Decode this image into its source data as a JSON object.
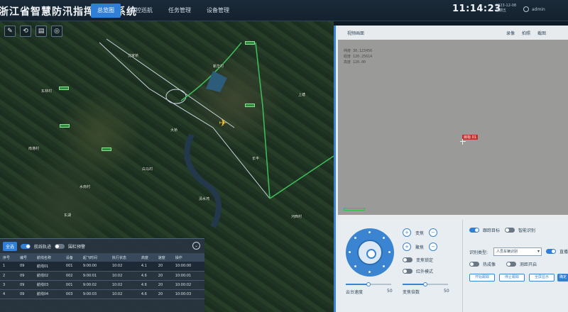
{
  "header": {
    "title": "浙江省智慧防汛指挥调度系统",
    "nav": [
      "总览图",
      "监控巡航",
      "任务管理",
      "设备管理"
    ],
    "active_nav": 0,
    "clock": "11:14:23",
    "date_line1": "2023-12-08",
    "date_line2": "星期五",
    "user": "admin"
  },
  "map": {
    "tools": [
      "edit-icon",
      "measure-icon",
      "layer-icon",
      "location-icon"
    ],
    "labels": [
      "东林村",
      "南港村",
      "沈家桥",
      "水南村",
      "新华村",
      "大桥",
      "上塘",
      "长丰",
      "东湖",
      "白马村",
      "清水湾",
      "河西村"
    ]
  },
  "list_panel": {
    "chip": "全选",
    "toggle1_label": "航线轨迹",
    "toggle2_label": "围栏预警",
    "columns": [
      "序号",
      "编号",
      "航线名称",
      "设备",
      "起飞时间",
      "执行状态",
      "高度",
      "速度",
      "操作"
    ],
    "rows": [
      [
        "1",
        "09",
        "航线01",
        "001",
        "9:00:00",
        "10:02",
        "4.1",
        "20",
        "10:00:00"
      ],
      [
        "2",
        "09",
        "航线02",
        "002",
        "9:00:01",
        "10:02",
        "4.6",
        "20",
        "10:00:01"
      ],
      [
        "3",
        "09",
        "航线03",
        "001",
        "9:00:02",
        "10:02",
        "4.6",
        "20",
        "10:00:02"
      ],
      [
        "4",
        "09",
        "航线04",
        "003",
        "9:00:03",
        "10:02",
        "4.6",
        "20",
        "10:00:03"
      ]
    ]
  },
  "video": {
    "title": "视频画面",
    "actions": [
      "录像",
      "拍照",
      "截图"
    ],
    "osd": "纬度 30.123456\n经度 120.25614\n高度 120.00",
    "target_label": "目标 01"
  },
  "controls": {
    "zoom_in_label": "变焦",
    "focus_label": "聚焦",
    "toggle_a_label": "变焦锁定",
    "toggle_b_label": "红外模式",
    "slider1_label": "云台速度",
    "slider1_value": "50",
    "slider1_level": 0.5,
    "slider2_label": "变焦倍数",
    "slider2_value": "50",
    "slider2_level": 0.5,
    "auto_track_label": "跟踪目标",
    "ai_label": "智能识别",
    "mode_label": "识别类型:",
    "mode_value": "人员车辆识别",
    "live_label": "直播",
    "opt1_label": "热成像",
    "opt2_label": "测距开启",
    "btn1": "开始跟踪",
    "btn2": "停止跟踪",
    "btn3": "全屏显示",
    "btn4": "确定"
  }
}
